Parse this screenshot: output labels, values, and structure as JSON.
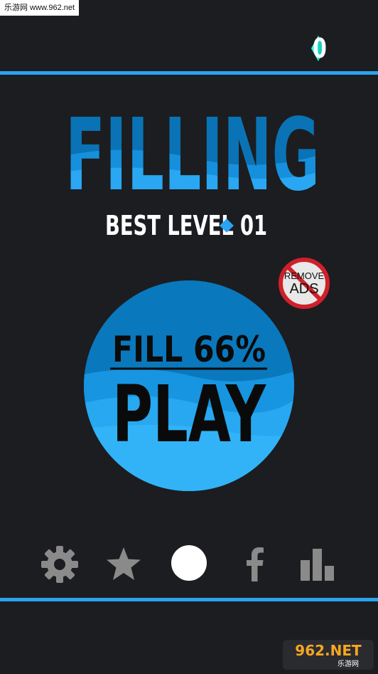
{
  "watermark": "乐游网 www.962.net",
  "header": {
    "gem_count": "0"
  },
  "title": "FILLING",
  "best_level": {
    "label": "BEST LEVEL",
    "value": "01"
  },
  "remove_ads": {
    "line1": "REMOVE",
    "line2": "ADS"
  },
  "play": {
    "fill_label": "FILL 66%",
    "play_label": "PLAY",
    "fill_fraction": 0.66
  },
  "bottom_nav": [
    {
      "icon": "gear-icon"
    },
    {
      "icon": "star-icon"
    },
    {
      "icon": "circle-icon"
    },
    {
      "icon": "facebook-icon"
    },
    {
      "icon": "leaderboard-icon"
    }
  ],
  "corner_logo": {
    "brand": "962.NET",
    "sub": "乐游网"
  },
  "colors": {
    "background": "#1c1d20",
    "accent": "#2aa3f0",
    "dark_blue": "#0a73b5",
    "light_blue": "#30b0f5",
    "icon_gray": "#8a8a8a",
    "no_sign_red": "#d0202a"
  }
}
